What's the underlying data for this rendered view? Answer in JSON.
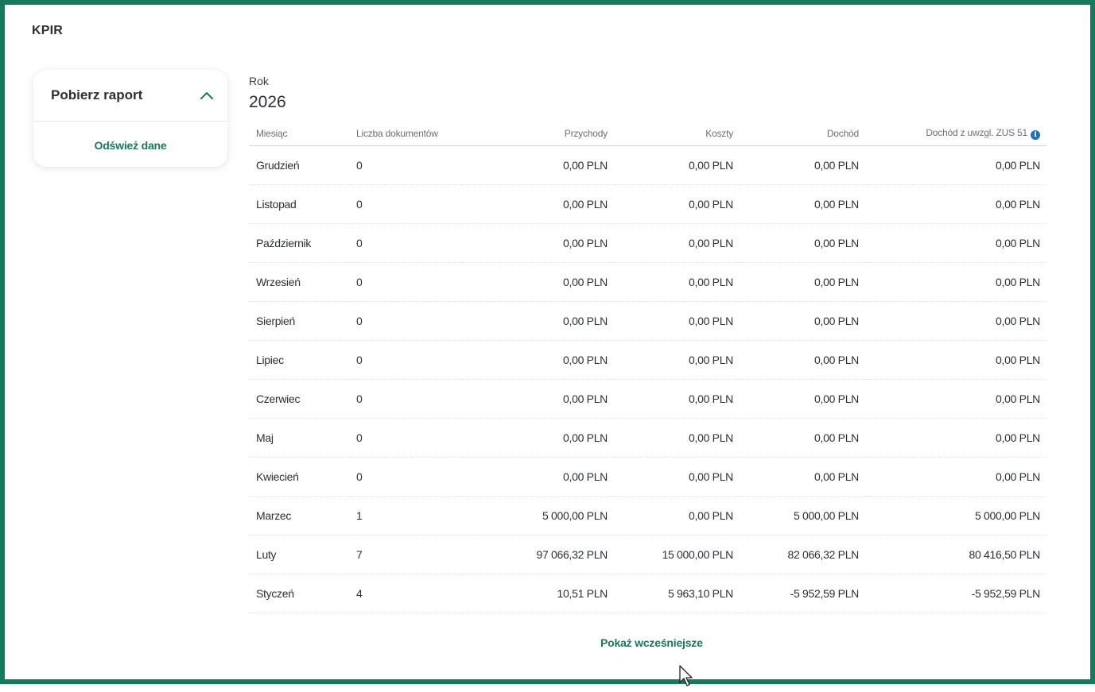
{
  "header": {
    "title": "KPIR"
  },
  "report_card": {
    "title": "Pobierz raport",
    "refresh_label": "Odśwież dane"
  },
  "year": {
    "label": "Rok",
    "value": "2026"
  },
  "table": {
    "columns": [
      "Miesiąc",
      "Liczba dokumentów",
      "Przychody",
      "Koszty",
      "Dochód",
      "Dochód z uwzgl. ZUS 51"
    ],
    "info_icon": "info-icon",
    "rows": [
      [
        "Grudzień",
        "0",
        "0,00 PLN",
        "0,00 PLN",
        "0,00 PLN",
        "0,00 PLN"
      ],
      [
        "Listopad",
        "0",
        "0,00 PLN",
        "0,00 PLN",
        "0,00 PLN",
        "0,00 PLN"
      ],
      [
        "Październik",
        "0",
        "0,00 PLN",
        "0,00 PLN",
        "0,00 PLN",
        "0,00 PLN"
      ],
      [
        "Wrzesień",
        "0",
        "0,00 PLN",
        "0,00 PLN",
        "0,00 PLN",
        "0,00 PLN"
      ],
      [
        "Sierpień",
        "0",
        "0,00 PLN",
        "0,00 PLN",
        "0,00 PLN",
        "0,00 PLN"
      ],
      [
        "Lipiec",
        "0",
        "0,00 PLN",
        "0,00 PLN",
        "0,00 PLN",
        "0,00 PLN"
      ],
      [
        "Czerwiec",
        "0",
        "0,00 PLN",
        "0,00 PLN",
        "0,00 PLN",
        "0,00 PLN"
      ],
      [
        "Maj",
        "0",
        "0,00 PLN",
        "0,00 PLN",
        "0,00 PLN",
        "0,00 PLN"
      ],
      [
        "Kwiecień",
        "0",
        "0,00 PLN",
        "0,00 PLN",
        "0,00 PLN",
        "0,00 PLN"
      ],
      [
        "Marzec",
        "1",
        "5 000,00 PLN",
        "0,00 PLN",
        "5 000,00 PLN",
        "5 000,00 PLN"
      ],
      [
        "Luty",
        "7",
        "97 066,32 PLN",
        "15 000,00 PLN",
        "82 066,32 PLN",
        "80 416,50 PLN"
      ],
      [
        "Styczeń",
        "4",
        "10,51 PLN",
        "5 963,10 PLN",
        "-5 952,59 PLN",
        "-5 952,59 PLN"
      ]
    ]
  },
  "footer": {
    "show_earlier_label": "Pokaż wcześniejsze"
  },
  "colors": {
    "accent": "#137a5c",
    "frame": "#137a5c",
    "info": "#1f6fbf"
  },
  "icons": {
    "collapse": "chevron-up-icon",
    "cursor": "mouse-pointer-icon"
  }
}
